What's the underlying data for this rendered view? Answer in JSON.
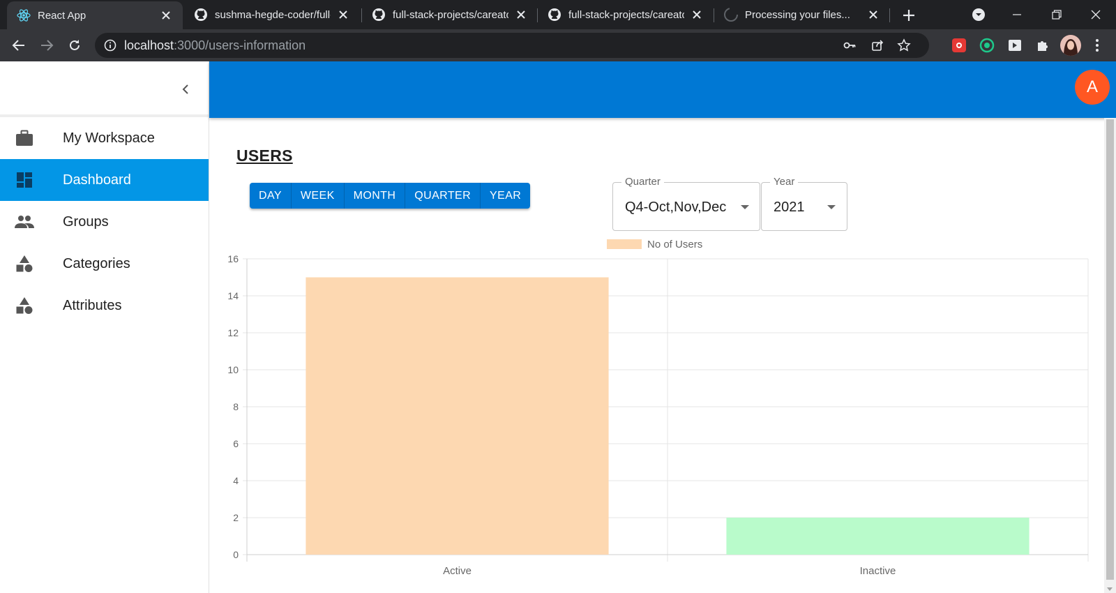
{
  "browser": {
    "tabs": [
      {
        "title": "React App",
        "icon": "react-icon",
        "active": true
      },
      {
        "title": "sushma-hegde-coder/full-",
        "icon": "github-icon",
        "active": false
      },
      {
        "title": "full-stack-projects/careato",
        "icon": "github-icon",
        "active": false
      },
      {
        "title": "full-stack-projects/careato",
        "icon": "github-icon",
        "active": false
      },
      {
        "title": "Processing your files...",
        "icon": "github-icon",
        "active": false
      }
    ],
    "address": {
      "host": "localhost",
      "path": ":3000/users-information"
    }
  },
  "sidebar": {
    "items": [
      {
        "label": "My Workspace",
        "icon": "briefcase-icon",
        "selected": false
      },
      {
        "label": "Dashboard",
        "icon": "dashboard-icon",
        "selected": true
      },
      {
        "label": "Groups",
        "icon": "people-icon",
        "selected": false
      },
      {
        "label": "Categories",
        "icon": "category-icon",
        "selected": false
      },
      {
        "label": "Attributes",
        "icon": "category-icon",
        "selected": false
      }
    ]
  },
  "header": {
    "avatar_letter": "A",
    "colors": {
      "appbar": "#0078d4",
      "avatar": "#ff5722",
      "selected": "#0396e6"
    }
  },
  "main": {
    "title": "USERS",
    "range_buttons": [
      "DAY",
      "WEEK",
      "MONTH",
      "QUARTER",
      "YEAR"
    ],
    "quarter_select": {
      "label": "Quarter",
      "value": "Q4-Oct,Nov,Dec"
    },
    "year_select": {
      "label": "Year",
      "value": "2021"
    }
  },
  "chart_data": {
    "type": "bar",
    "categories": [
      "Active",
      "Inactive"
    ],
    "series": [
      {
        "name": "No of Users",
        "values": [
          15,
          2
        ]
      }
    ],
    "bar_colors": [
      "#fdd8b1",
      "#b9fbcb"
    ],
    "legend_color": "#fdd8b1",
    "ylim": [
      0,
      16
    ],
    "yticks": [
      0,
      2,
      4,
      6,
      8,
      10,
      12,
      14,
      16
    ],
    "grid": true,
    "legend": "top-center"
  }
}
